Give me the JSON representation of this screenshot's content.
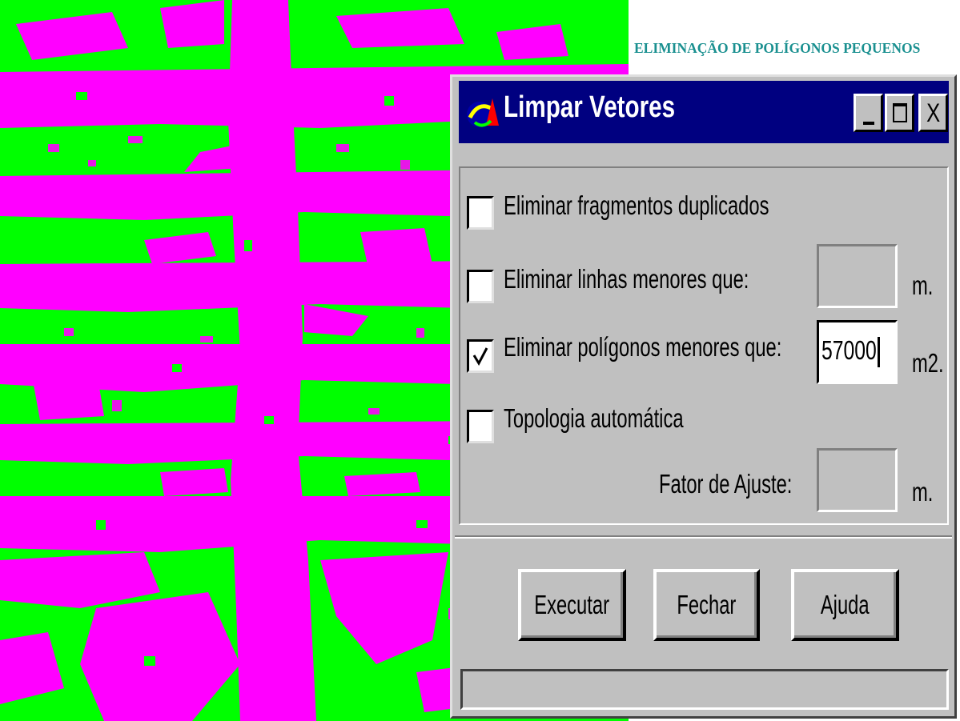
{
  "heading": "ELIMINAÇÃO DE POLÍGONOS PEQUENOS",
  "raster": {
    "foreground_color": "#ff00ff",
    "background_color": "#00ff00"
  },
  "dialog": {
    "title": "Limpar Vetores",
    "icon": "app-logo-icon",
    "title_buttons": [
      "minimize-icon",
      "maximize-icon",
      "close-icon"
    ],
    "close_glyph": "X",
    "options": [
      {
        "label": "Eliminar fragmentos duplicados",
        "checked": false
      },
      {
        "label": "Eliminar linhas menores que:",
        "checked": false,
        "value": "",
        "unit": "m."
      },
      {
        "label": "Eliminar polígonos menores que:",
        "checked": true,
        "value": "57000",
        "unit": "m2."
      },
      {
        "label": "Topologia automática",
        "checked": false
      }
    ],
    "adjust_factor": {
      "label": "Fator de Ajuste:",
      "value": "",
      "unit": "m."
    },
    "buttons": {
      "execute": "Executar",
      "close": "Fechar",
      "help": "Ajuda"
    },
    "status": ""
  }
}
